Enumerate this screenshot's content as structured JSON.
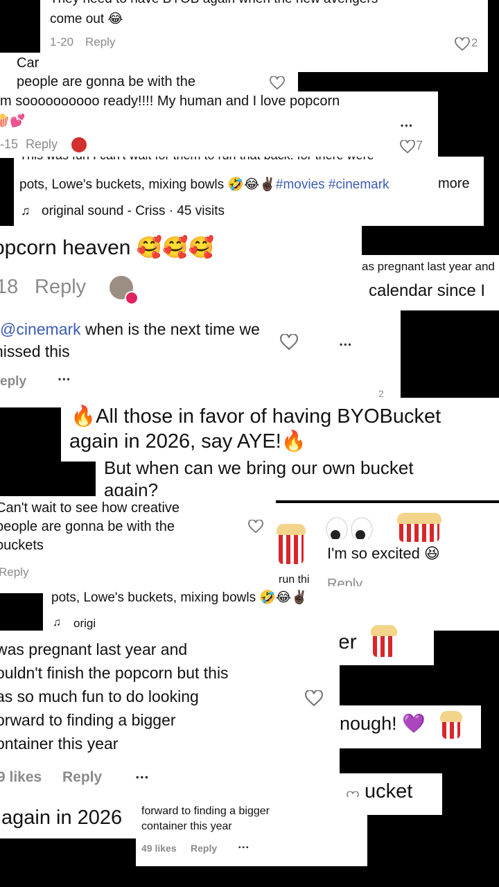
{
  "c1": {
    "text1": "They need to have BYOB again when the new avengers",
    "text2": "come out 😂",
    "date": "1-20",
    "reply": "Reply",
    "likes": "2"
  },
  "c2": {
    "line1": "Car",
    "line2": "people are gonna be with the"
  },
  "c3": {
    "line1": "m soooooooooo ready!!!! My human and I love popcorn",
    "emoji": "🍿💕",
    "date": "-15",
    "reply": "Reply",
    "likes": "7",
    "dots": "•••"
  },
  "c4": {
    "line0": "This was fun I can't wait for them to run that back! for there were",
    "line1": "pots, Lowe's buckets, mixing bowls 🤣😂✌🏿",
    "tags": "#movies #cinemark",
    "more": "more",
    "sound": "original sound - Criss · 45 visits"
  },
  "c5": {
    "text": "opcorn heaven 🥰🥰🥰",
    "date": "18",
    "reply": "Reply"
  },
  "c6": {
    "line1": "as pregnant last year and",
    "line2": "calendar since I"
  },
  "c7": {
    "mention": "@cinemark",
    "text": " when is the next time we",
    "line2": "nissed this",
    "reply": "eply",
    "dots": "•••",
    "dots2": "•••",
    "likes2": "2"
  },
  "c8": {
    "line1": "🔥All those in favor of having BYOBucket",
    "line2": "again in 2026, say AYE!🔥"
  },
  "c9": {
    "line1": "But when can we bring our own bucket",
    "line2": "again?"
  },
  "c10": {
    "line1": "Can't wait to see how creative",
    "line2": "people are gonna be with the",
    "line3": "buckets",
    "reply": "Reply"
  },
  "c11": {
    "text": "I'm so excited 😆",
    "frag": "run thi",
    "reply": "Reply"
  },
  "c12": {
    "line1": "pots, Lowe's buckets, mixing bowls 🤣😂✌🏿",
    "sound": "origi"
  },
  "c13": {
    "frag": "er"
  },
  "c14": {
    "line1": "was pregnant last year and",
    "line2": "ouldn't finish the popcorn but this",
    "line3": "as so much fun to do looking",
    "line4": "orward to finding a bigger",
    "line5": "ontainer this year",
    "likes": "9 likes",
    "reply": "Reply",
    "dots": "•••"
  },
  "c15": {
    "text": "nough! 💜"
  },
  "c16": {
    "text": "ucket"
  },
  "c17": {
    "text": "again in 2026"
  },
  "c18": {
    "line1": "forward to finding a bigger",
    "line2": "container this year",
    "likes": "49 likes",
    "reply": "Reply",
    "dots": "•••"
  }
}
